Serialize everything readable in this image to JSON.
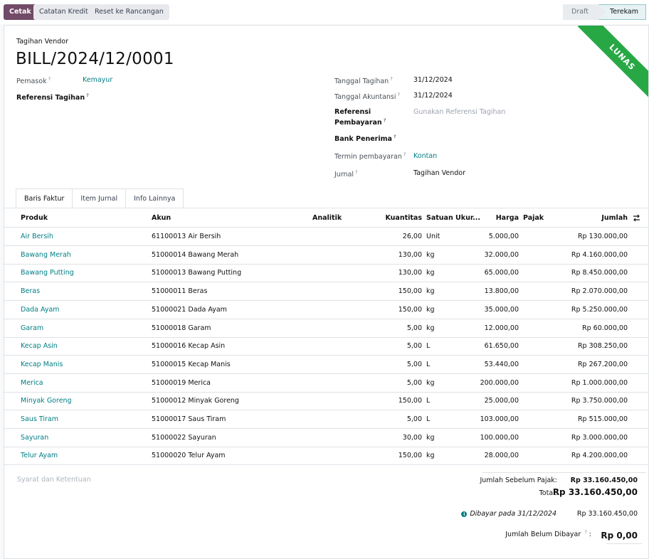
{
  "control": {
    "buttons": [
      "Cetak",
      "Catatan Kredit",
      "Reset ke Rancangan"
    ],
    "status": [
      "Draft",
      "Terekam"
    ]
  },
  "ribbon": "LUNAS",
  "doc": {
    "type": "Tagihan Vendor",
    "name": "BILL/2024/12/0001"
  },
  "left_fields": {
    "supplier_label": "Pemasok",
    "supplier_value": "Kemayur",
    "bill_ref_label": "Referensi Tagihan"
  },
  "right_fields": {
    "bill_date_label": "Tanggal Tagihan",
    "bill_date": "31/12/2024",
    "acc_date_label": "Tanggal Akuntansi",
    "acc_date": "31/12/2024",
    "pay_ref_label_1": "Referensi",
    "pay_ref_label_2": "Pembayaran",
    "pay_ref_placeholder": "Gunakan Referensi Tagihan",
    "bank_label": "Bank Penerima",
    "terms_label": "Termin pembayaran",
    "terms_value": "Kontan",
    "journal_label": "Jurnal",
    "journal_value": "Tagihan Vendor"
  },
  "tabs": [
    "Baris Faktur",
    "Item Jurnal",
    "Info Lainnya"
  ],
  "table": {
    "columns": [
      "Produk",
      "Akun",
      "Analitik",
      "Kuantitas",
      "Satuan Ukur...",
      "Harga",
      "Pajak",
      "Jumlah"
    ],
    "rows": [
      {
        "product": "Air Bersih",
        "account": "61100013 Air Bersih",
        "qty": "26,00",
        "uom": "Unit",
        "price": "5.000,00",
        "total": "Rp 130.000,00"
      },
      {
        "product": "Bawang Merah",
        "account": "51000014 Bawang Merah",
        "qty": "130,00",
        "uom": "kg",
        "price": "32.000,00",
        "total": "Rp 4.160.000,00"
      },
      {
        "product": "Bawang Putting",
        "account": "51000013 Bawang Putting",
        "qty": "130,00",
        "uom": "kg",
        "price": "65.000,00",
        "total": "Rp 8.450.000,00"
      },
      {
        "product": "Beras",
        "account": "51000011 Beras",
        "qty": "150,00",
        "uom": "kg",
        "price": "13.800,00",
        "total": "Rp 2.070.000,00"
      },
      {
        "product": "Dada Ayam",
        "account": "51000021 Dada Ayam",
        "qty": "150,00",
        "uom": "kg",
        "price": "35.000,00",
        "total": "Rp 5.250.000,00"
      },
      {
        "product": "Garam",
        "account": "51000018 Garam",
        "qty": "5,00",
        "uom": "kg",
        "price": "12.000,00",
        "total": "Rp 60.000,00"
      },
      {
        "product": "Kecap Asin",
        "account": "51000016 Kecap Asin",
        "qty": "5,00",
        "uom": "L",
        "price": "61.650,00",
        "total": "Rp 308.250,00"
      },
      {
        "product": "Kecap Manis",
        "account": "51000015 Kecap Manis",
        "qty": "5,00",
        "uom": "L",
        "price": "53.440,00",
        "total": "Rp 267.200,00"
      },
      {
        "product": "Merica",
        "account": "51000019 Merica",
        "qty": "5,00",
        "uom": "kg",
        "price": "200.000,00",
        "total": "Rp 1.000.000,00"
      },
      {
        "product": "Minyak Goreng",
        "account": "51000012 Minyak Goreng",
        "qty": "150,00",
        "uom": "L",
        "price": "25.000,00",
        "total": "Rp 3.750.000,00"
      },
      {
        "product": "Saus Tiram",
        "account": "51000017 Saus Tiram",
        "qty": "5,00",
        "uom": "L",
        "price": "103.000,00",
        "total": "Rp 515.000,00"
      },
      {
        "product": "Sayuran",
        "account": "51000022 Sayuran",
        "qty": "30,00",
        "uom": "kg",
        "price": "100.000,00",
        "total": "Rp 3.000.000,00"
      },
      {
        "product": "Telur Ayam",
        "account": "51000020 Telur Ayam",
        "qty": "150,00",
        "uom": "kg",
        "price": "28.000,00",
        "total": "Rp 4.200.000,00"
      }
    ]
  },
  "footer": {
    "terms_placeholder": "Syarat dan Ketentuan",
    "untaxed_label": "Jumlah Sebelum Pajak:",
    "untaxed_value": "Rp 33.160.450,00",
    "total_label": "Total:",
    "total_value": "Rp 33.160.450,00",
    "paid_label": "Dibayar pada 31/12/2024",
    "paid_value": "Rp 33.160.450,00",
    "due_label": "Jumlah Belum Dibayar",
    "due_value": "Rp 0,00"
  }
}
